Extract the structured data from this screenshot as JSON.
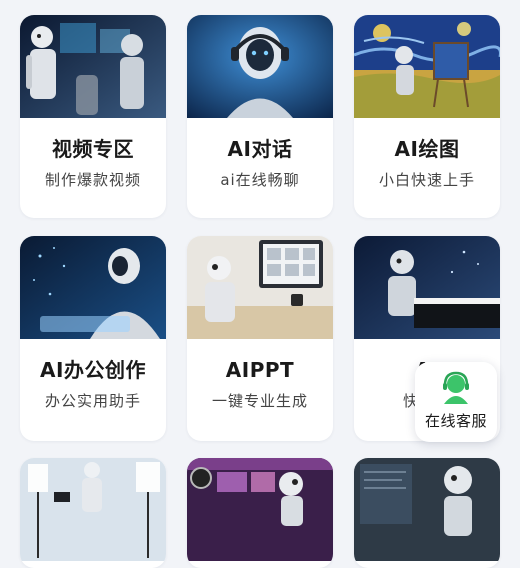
{
  "cards": [
    {
      "title": "视频专区",
      "subtitle": "制作爆款视频",
      "image": "robots-in-studio"
    },
    {
      "title": "AI对话",
      "subtitle": "ai在线畅聊",
      "image": "robot-with-headset"
    },
    {
      "title": "AI绘图",
      "subtitle": "小白快速上手",
      "image": "robot-painting-starry-night"
    },
    {
      "title": "AI办公创作",
      "subtitle": "办公实用助手",
      "image": "robot-typing-keyboard"
    },
    {
      "title": "AIPPT",
      "subtitle": "一键专业生成",
      "image": "robot-at-desk-monitor"
    },
    {
      "title": "AI",
      "subtitle": "快速生",
      "image": "robot-playing-piano"
    },
    {
      "title": "",
      "subtitle": "",
      "image": "robot-photo-studio"
    },
    {
      "title": "",
      "subtitle": "",
      "image": "robot-video-editing"
    },
    {
      "title": "",
      "subtitle": "",
      "image": "robot-data-screen"
    }
  ],
  "customer_service": {
    "label": "在线客服",
    "icon": "headset-avatar-icon",
    "accent": "#3cc46a"
  }
}
